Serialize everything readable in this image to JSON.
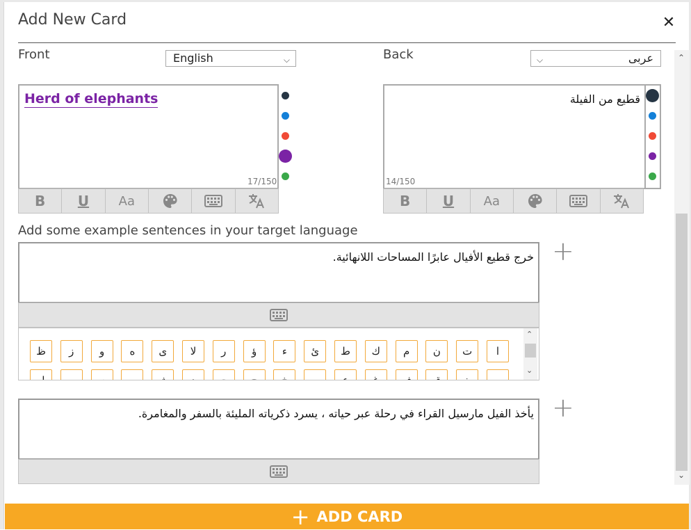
{
  "dialog": {
    "title": "Add New Card"
  },
  "front": {
    "label": "Front",
    "language": "English",
    "text": "Herd of elephants",
    "counter": "17/150",
    "text_color": "#7b23a5"
  },
  "back": {
    "label": "Back",
    "language": "عربى",
    "text": "قطيع من الفيلة",
    "counter": "14/150"
  },
  "swatch_colors": [
    "#263544",
    "#1480d8",
    "#f04a36",
    "#7b23a5",
    "#3aa84a"
  ],
  "toolbar": {
    "bold": "B",
    "underline": "U",
    "font_size": "Aa"
  },
  "examples": {
    "label": "Add some example sentences in your target language",
    "sentences": [
      "خرج قطيع الأفيال عابرًا المساحات اللانهائية.",
      "يأخذ الفيل مارسيل القراء في رحلة عبر حياته ، يسرد ذكرياته المليئة بالسفر والمغامرة."
    ]
  },
  "keyboard": {
    "row1": [
      "ظ",
      "ز",
      "و",
      "ه",
      "ى",
      "لا",
      "ر",
      "ؤ",
      "ء",
      "ئ",
      "ط",
      "ك",
      "م",
      "ن",
      "ت",
      "ا"
    ],
    "row2": [
      "ل",
      "ب",
      "ي",
      "س",
      "ش",
      "د",
      "ج",
      "ح",
      "خ",
      "ه",
      "ع",
      "غ",
      "ف",
      "ق",
      "ث",
      "ص"
    ]
  },
  "footer": {
    "add_card": "ADD CARD"
  },
  "accent_color": "#f7a823"
}
